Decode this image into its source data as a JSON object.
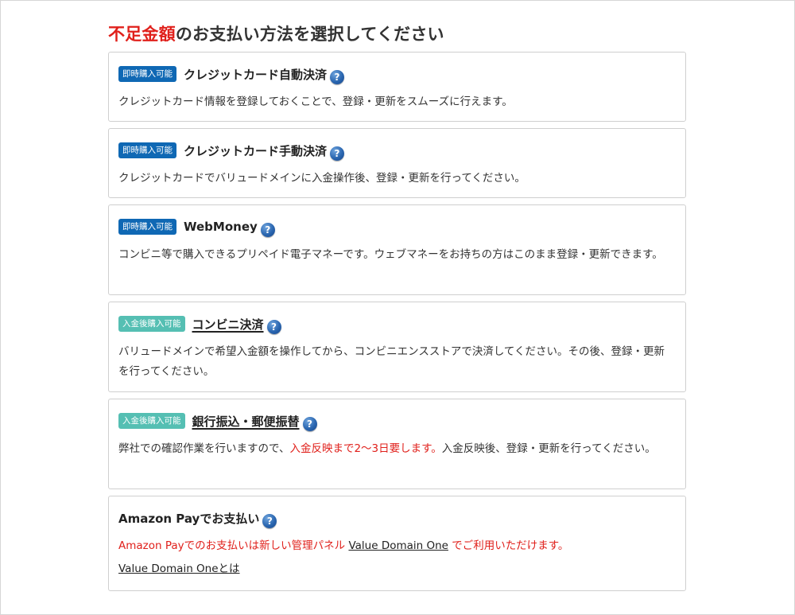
{
  "heading": {
    "accent": "不足金額",
    "rest": "のお支払い方法を選択してください"
  },
  "options": [
    {
      "badge": "即時購入可能",
      "title": "クレジットカード自動決済",
      "description": "クレジットカード情報を登録しておくことで、登録・更新をスムーズに行えます。"
    },
    {
      "badge": "即時購入可能",
      "title": "クレジットカード手動決済",
      "description": "クレジットカードでバリュードメインに入金操作後、登録・更新を行ってください。"
    },
    {
      "badge": "即時購入可能",
      "title": "WebMoney",
      "description": "コンビニ等で購入できるプリペイド電子マネーです。ウェブマネーをお持ちの方はこのまま登録・更新できます。"
    },
    {
      "badge": "入金後購入可能",
      "title": "コンビニ決済",
      "description": "バリュードメインで希望入金額を操作してから、コンビニエンスストアで決済してください。その後、登録・更新を行ってください。"
    },
    {
      "badge": "入金後購入可能",
      "title": "銀行振込・郵便振替",
      "description_before": "弊社での確認作業を行いますので、",
      "description_highlight": "入金反映まで2〜3日要します。",
      "description_after": "入金反映後、登録・更新を行ってください。"
    }
  ],
  "amazon": {
    "title": "Amazon Payでお支払い",
    "notice_before": "Amazon Payでのお支払いは新しい管理パネル ",
    "notice_link": "Value Domain One",
    "notice_after": " でご利用いただけます。",
    "about_link": "Value Domain Oneとは"
  },
  "help_icon_glyph": "?",
  "colors": {
    "accent_red": "#e0201b",
    "badge_immediate": "#0f68b4",
    "badge_after_deposit": "#55bfb3",
    "help_icon": "#2a66b0"
  }
}
